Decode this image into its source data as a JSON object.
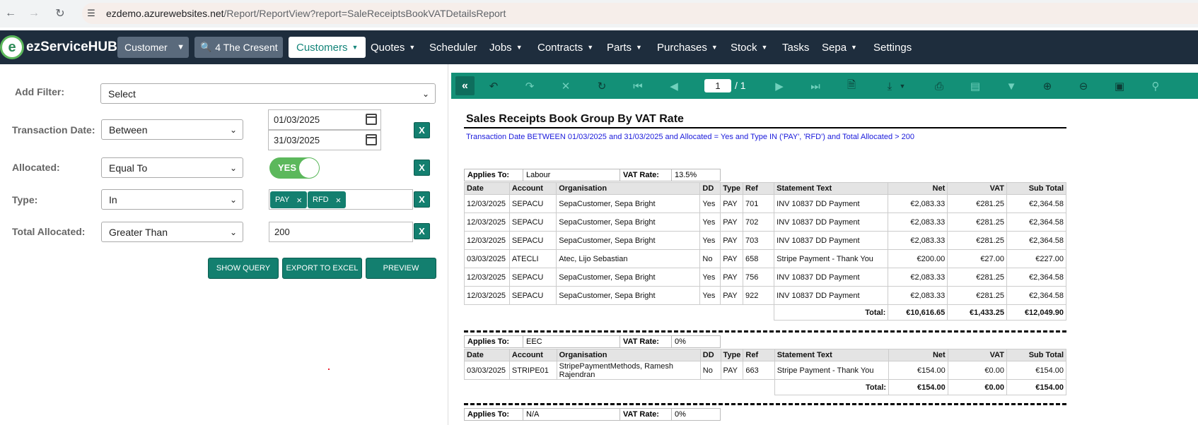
{
  "browser": {
    "url_host": "ezdemo.azurewebsites.net",
    "url_path": "/Report/ReportView?report=SaleReceiptsBookVATDetailsReport"
  },
  "nav": {
    "logo": "ezServiceHUB",
    "entity_select": "Customer",
    "search_value": "4 The Cresent",
    "items": [
      "Customers",
      "Quotes",
      "Scheduler",
      "Jobs",
      "Contracts",
      "Parts",
      "Purchases",
      "Stock",
      "Tasks",
      "Sepa",
      "Settings"
    ]
  },
  "filters": {
    "add_filter_label": "Add Filter:",
    "add_filter_value": "Select",
    "date_label": "Transaction Date:",
    "date_op": "Between",
    "date_from": "01/03/2025",
    "date_to": "31/03/2025",
    "allocated_label": "Allocated:",
    "allocated_op": "Equal To",
    "allocated_toggle": "YES",
    "type_label": "Type:",
    "type_op": "In",
    "type_tags": [
      "PAY",
      "RFD"
    ],
    "total_label": "Total Allocated:",
    "total_op": "Greater Than",
    "total_value": "200",
    "remove_label": "X",
    "show_query": "SHOW QUERY",
    "export_excel": "EXPORT TO EXCEL",
    "preview": "PREVIEW"
  },
  "viewer": {
    "page": "1",
    "page_total": "/ 1"
  },
  "report": {
    "title": "Sales Receipts Book Group By VAT Rate",
    "subtitle": "Transaction Date BETWEEN 01/03/2025 and 31/03/2025 and Allocated = Yes and Type IN ('PAY', 'RFD') and Total Allocated > 200",
    "applies_label": "Applies To:",
    "vat_label": "VAT Rate:",
    "total_label": "Total:",
    "columns": [
      "Date",
      "Account",
      "Organisation",
      "DD",
      "Type",
      "Ref",
      "Statement Text",
      "Net",
      "VAT",
      "Sub Total"
    ],
    "groups": [
      {
        "applies_to": "Labour",
        "vat_rate": "13.5%",
        "rows": [
          [
            "12/03/2025",
            "SEPACU",
            "SepaCustomer, Sepa Bright",
            "Yes",
            "PAY",
            "701",
            "INV 10837 DD Payment",
            "€2,083.33",
            "€281.25",
            "€2,364.58"
          ],
          [
            "12/03/2025",
            "SEPACU",
            "SepaCustomer, Sepa Bright",
            "Yes",
            "PAY",
            "702",
            "INV 10837 DD Payment",
            "€2,083.33",
            "€281.25",
            "€2,364.58"
          ],
          [
            "12/03/2025",
            "SEPACU",
            "SepaCustomer, Sepa Bright",
            "Yes",
            "PAY",
            "703",
            "INV 10837 DD Payment",
            "€2,083.33",
            "€281.25",
            "€2,364.58"
          ],
          [
            "03/03/2025",
            "ATECLI",
            "Atec, Lijo Sebastian",
            "No",
            "PAY",
            "658",
            "Stripe Payment - Thank You",
            "€200.00",
            "€27.00",
            "€227.00"
          ],
          [
            "12/03/2025",
            "SEPACU",
            "SepaCustomer, Sepa Bright",
            "Yes",
            "PAY",
            "756",
            "INV 10837 DD Payment",
            "€2,083.33",
            "€281.25",
            "€2,364.58"
          ],
          [
            "12/03/2025",
            "SEPACU",
            "SepaCustomer, Sepa Bright",
            "Yes",
            "PAY",
            "922",
            "INV 10837 DD Payment",
            "€2,083.33",
            "€281.25",
            "€2,364.58"
          ]
        ],
        "total": [
          "€10,616.65",
          "€1,433.25",
          "€12,049.90"
        ]
      },
      {
        "applies_to": "EEC",
        "vat_rate": "0%",
        "rows": [
          [
            "03/03/2025",
            "STRIPE01",
            "StripePaymentMethods, Ramesh Rajendran",
            "No",
            "PAY",
            "663",
            "Stripe Payment - Thank You",
            "€154.00",
            "€0.00",
            "€154.00"
          ]
        ],
        "total": [
          "€154.00",
          "€0.00",
          "€154.00"
        ]
      },
      {
        "applies_to": "N/A",
        "vat_rate": "0%"
      }
    ]
  }
}
